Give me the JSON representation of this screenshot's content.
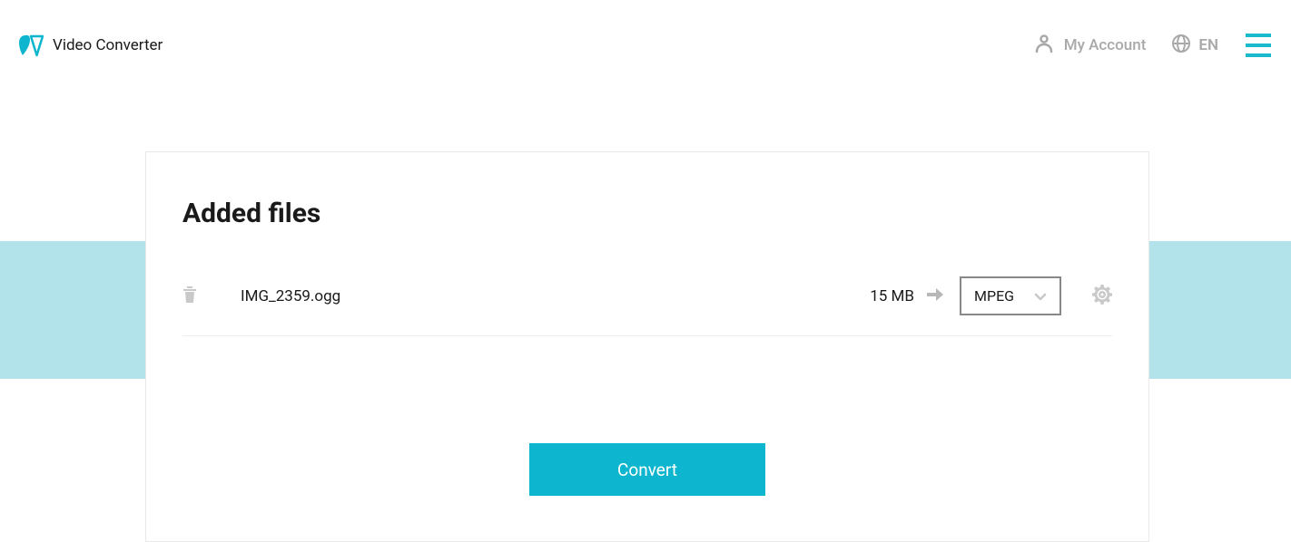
{
  "header": {
    "app_title": "Video Converter",
    "my_account_label": "My Account",
    "language_label": "EN"
  },
  "card": {
    "title": "Added files",
    "convert_button_label": "Convert"
  },
  "files": [
    {
      "name": "IMG_2359.ogg",
      "size": "15 MB",
      "target_format": "MPEG"
    }
  ]
}
